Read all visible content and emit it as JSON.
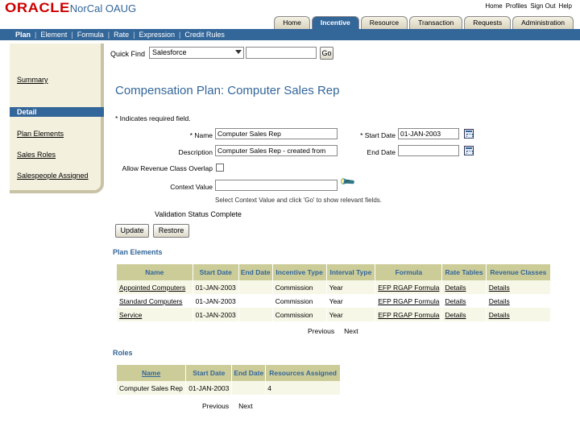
{
  "brand": {
    "oracle": "ORACLE",
    "org": "NorCal OAUG"
  },
  "global_links": [
    "Home",
    "Profiles",
    "Sign Out",
    "Help"
  ],
  "tabs": [
    {
      "label": "Home",
      "active": false
    },
    {
      "label": "Incentive",
      "active": true
    },
    {
      "label": "Resource",
      "active": false
    },
    {
      "label": "Transaction",
      "active": false
    },
    {
      "label": "Requests",
      "active": false
    },
    {
      "label": "Administration",
      "active": false
    }
  ],
  "subnav": [
    "Plan",
    "Element",
    "Formula",
    "Rate",
    "Expression",
    "Credit Rules"
  ],
  "quick_find": {
    "label": "Quick Find",
    "selected": "Salesforce",
    "button": "Go"
  },
  "sidenav": {
    "summary": "Summary",
    "detail": "Detail",
    "plan_elements": "Plan Elements",
    "sales_roles": "Sales Roles",
    "salespeople": "Salespeople Assigned"
  },
  "page_title": "Compensation Plan: Computer Sales Rep",
  "required_note": "* Indicates required field.",
  "form": {
    "name_label": "* Name",
    "name_value": "Computer Sales Rep",
    "description_label": "Description",
    "description_value": "Computer Sales Rep - created from",
    "start_date_label": "* Start Date",
    "start_date_value": "01-JAN-2003",
    "end_date_label": "End Date",
    "end_date_value": "",
    "overlap_label": "Allow Revenue Class Overlap",
    "context_label": "Context Value",
    "context_value": "",
    "hint": "Select Context Value and click 'Go' to show relevant fields.",
    "status": "Validation Status Complete",
    "update_button": "Update",
    "restore_button": "Restore"
  },
  "plan_elements": {
    "title": "Plan Elements",
    "columns": [
      "Name",
      "Start Date",
      "End Date",
      "Incentive Type",
      "Interval Type",
      "Formula",
      "Rate Tables",
      "Revenue Classes"
    ],
    "rows": [
      [
        "Appointed Computers",
        "01-JAN-2003",
        "",
        "Commission",
        "Year",
        "EFP RGAP Formula",
        "Details",
        "Details"
      ],
      [
        "Standard Computers",
        "01-JAN-2003",
        "",
        "Commission",
        "Year",
        "EFP RGAP Formula",
        "Details",
        "Details"
      ],
      [
        "Service",
        "01-JAN-2003",
        "",
        "Commission",
        "Year",
        "EFP RGAP Formula",
        "Details",
        "Details"
      ]
    ],
    "previous": "Previous",
    "next": "Next"
  },
  "roles": {
    "title": "Roles",
    "columns": [
      "Name",
      "Start Date",
      "End Date",
      "Resources Assigned"
    ],
    "rows": [
      [
        "Computer Sales Rep",
        "01-JAN-2003",
        "",
        "4"
      ]
    ],
    "previous": "Previous",
    "next": "Next"
  }
}
